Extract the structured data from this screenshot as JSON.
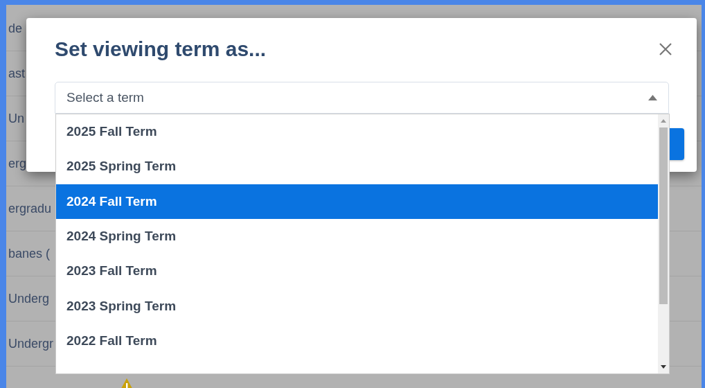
{
  "background_rows": [
    {
      "text": "de"
    },
    {
      "text": "ast"
    },
    {
      "text": "Un"
    },
    {
      "text": "erg"
    },
    {
      "text": "ergradu"
    },
    {
      "text": "banes ("
    },
    {
      "text": "Underg"
    },
    {
      "text": "Undergr"
    }
  ],
  "dialog": {
    "title": "Set viewing term as...",
    "select": {
      "placeholder": "Select a term",
      "expanded": true
    },
    "options": [
      {
        "label": "2025 Fall Term",
        "selected": false
      },
      {
        "label": "2025 Spring Term",
        "selected": false
      },
      {
        "label": "2024 Fall Term",
        "selected": true
      },
      {
        "label": "2024 Spring Term",
        "selected": false
      },
      {
        "label": "2023 Fall Term",
        "selected": false
      },
      {
        "label": "2023 Spring Term",
        "selected": false
      },
      {
        "label": "2022 Fall Term",
        "selected": false
      }
    ]
  }
}
